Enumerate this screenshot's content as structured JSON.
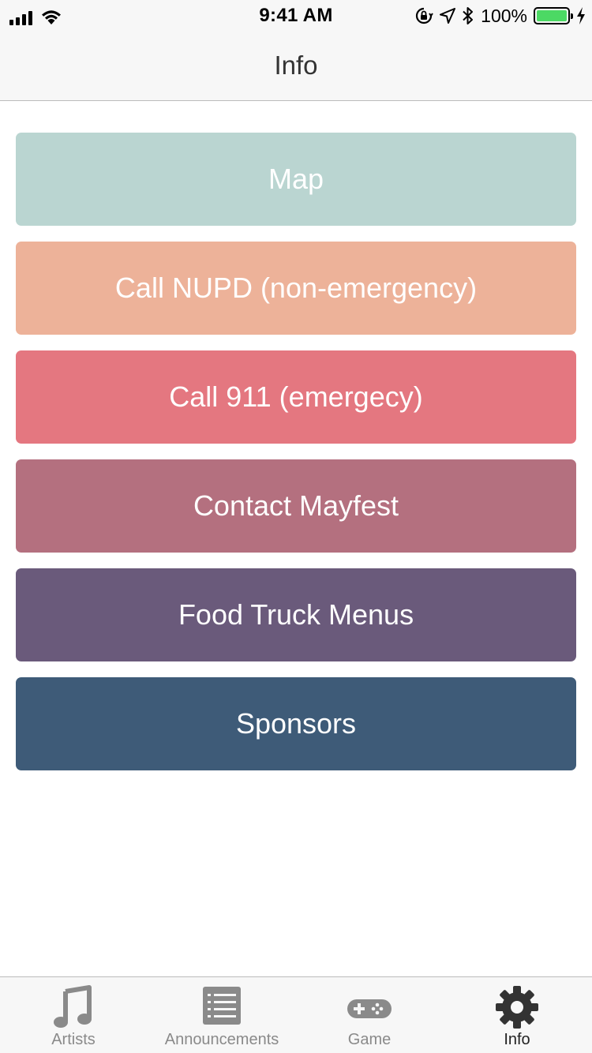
{
  "status_bar": {
    "time": "9:41 AM",
    "battery_percent": "100%",
    "battery_level": 1.0,
    "icons": [
      "cellular-signal-icon",
      "wifi-icon",
      "orientation-lock-icon",
      "location-icon",
      "bluetooth-icon",
      "battery-icon",
      "charging-icon"
    ]
  },
  "nav": {
    "title": "Info"
  },
  "buttons": [
    {
      "label": "Map",
      "color": "#bad5d1"
    },
    {
      "label": "Call NUPD (non-emergency)",
      "color": "#edb299"
    },
    {
      "label": "Call 911 (emergecy)",
      "color": "#e47780"
    },
    {
      "label": "Contact Mayfest",
      "color": "#b4707f"
    },
    {
      "label": "Food Truck Menus",
      "color": "#6a5a7b"
    },
    {
      "label": "Sponsors",
      "color": "#3e5b78"
    }
  ],
  "tabs": [
    {
      "label": "Artists",
      "icon": "music-note-icon",
      "active": false
    },
    {
      "label": "Announcements",
      "icon": "list-icon",
      "active": false
    },
    {
      "label": "Game",
      "icon": "gamepad-icon",
      "active": false
    },
    {
      "label": "Info",
      "icon": "gear-icon",
      "active": true
    }
  ],
  "colors": {
    "tab_inactive": "#8a8a8a",
    "tab_active": "#333333",
    "bar_background": "#f7f7f7"
  }
}
